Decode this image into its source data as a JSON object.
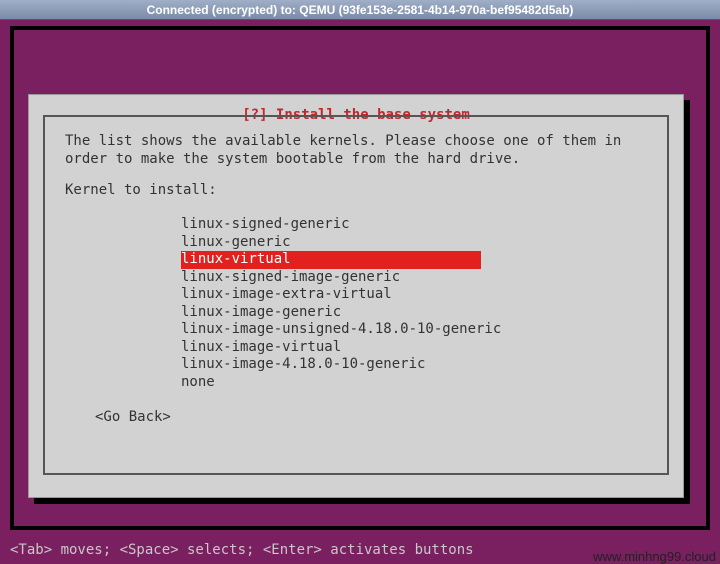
{
  "titlebar": "Connected (encrypted) to: QEMU (93fe153e-2581-4b14-970a-bef95482d5ab)",
  "dialog": {
    "title": "[?] Install the base system",
    "instruction": "The list shows the available kernels. Please choose one of them in order to make the system bootable from the hard drive.",
    "prompt": "Kernel to install:",
    "items": [
      "linux-signed-generic",
      "linux-generic",
      "linux-virtual",
      "linux-signed-image-generic",
      "linux-image-extra-virtual",
      "linux-image-generic",
      "linux-image-unsigned-4.18.0-10-generic",
      "linux-image-virtual",
      "linux-image-4.18.0-10-generic",
      "none"
    ],
    "selected_index": 2,
    "goback": "<Go Back>"
  },
  "hints": "<Tab> moves; <Space> selects; <Enter> activates buttons",
  "watermark": "www.minhng99.cloud"
}
